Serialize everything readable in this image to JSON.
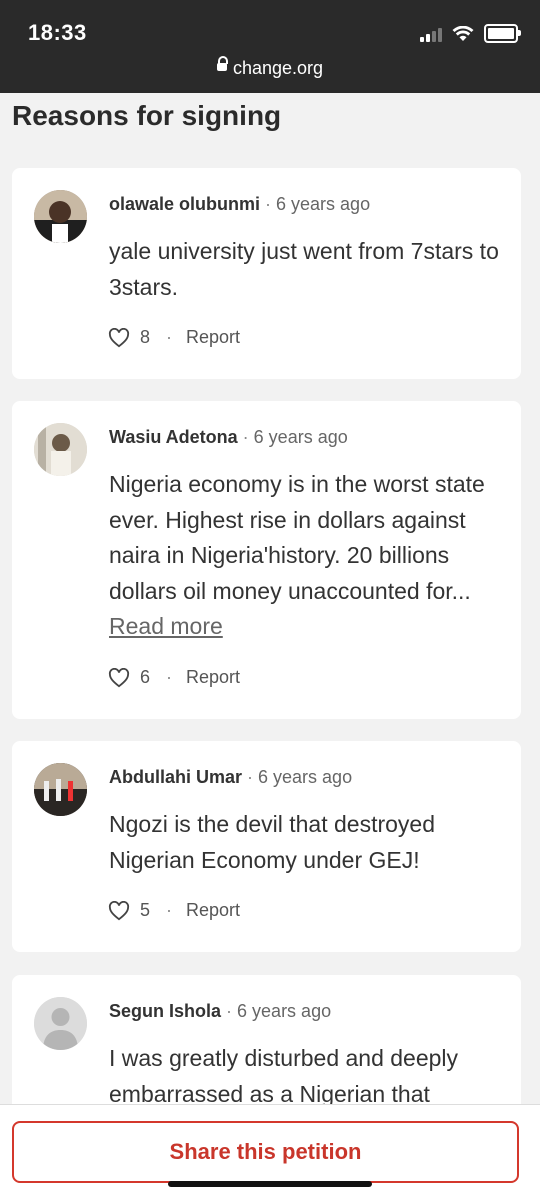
{
  "status_bar": {
    "time": "18:33",
    "url": "change.org"
  },
  "section_title": "Reasons for signing",
  "comments": [
    {
      "name": "olawale olubunmi",
      "time_ago": "6 years ago",
      "text": "yale university just went from 7stars to 3stars.",
      "read_more": "",
      "likes": "8",
      "report_label": "Report"
    },
    {
      "name": "Wasiu Adetona",
      "time_ago": "6 years ago",
      "text": "Nigeria economy is in the worst state ever. Highest rise in dollars against naira in Nigeria'history. 20 billions dollars oil money unaccounted for...",
      "read_more": "Read more",
      "likes": "6",
      "report_label": "Report"
    },
    {
      "name": "Abdullahi Umar",
      "time_ago": "6 years ago",
      "text": "Ngozi is the devil that destroyed Nigerian Economy under GEJ!",
      "read_more": "",
      "likes": "5",
      "report_label": "Report"
    },
    {
      "name": "Segun Ishola",
      "time_ago": "6 years ago",
      "text": "I was greatly disturbed and deeply embarrassed as a Nigerian that",
      "read_more": "",
      "likes": "",
      "report_label": ""
    }
  ],
  "share_button_label": "Share this petition",
  "colors": {
    "accent": "#c9362b",
    "background": "#f2f2f2",
    "status_bar": "#2a2a2a"
  }
}
